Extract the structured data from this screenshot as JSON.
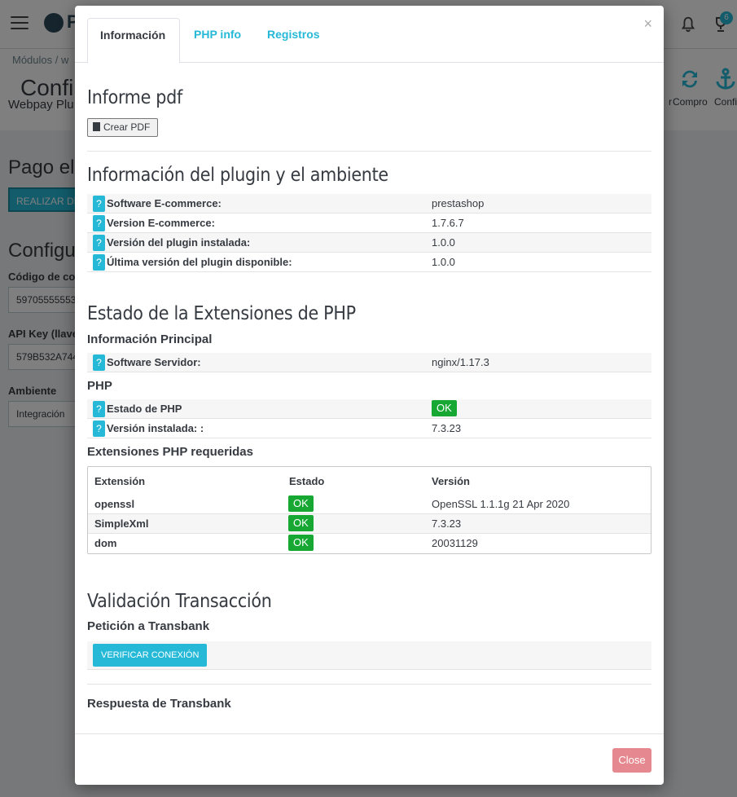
{
  "background": {
    "breadcrumb": "Módulos  /  w",
    "title": "Confi",
    "subtitle": "Webpay Plu",
    "toolbar": [
      {
        "label": "r",
        "icon": "sync-icon"
      },
      {
        "label": "Compro",
        "icon": "refresh-icon"
      },
      {
        "label": "Confi",
        "icon": "anchor-icon"
      }
    ],
    "notification_count": "6",
    "section1_title": "Pago elec",
    "action_button": "REALIZAR DIA",
    "section2_title": "Configura",
    "fields": [
      {
        "label": "Código de con",
        "value": "597055555532"
      },
      {
        "label": "API Key (llave",
        "value": "579B532A744"
      },
      {
        "label": "Ambiente",
        "value": "Integración"
      }
    ]
  },
  "modal": {
    "tabs": [
      "Información",
      "PHP info",
      "Registros"
    ],
    "close_symbol": "×",
    "pdf_section": {
      "title": "Informe pdf",
      "button": "Crear PDF"
    },
    "plugin_section": {
      "title": "Información del plugin y el ambiente",
      "rows": [
        {
          "key": "Software E-commerce:",
          "value": "prestashop"
        },
        {
          "key": "Version E-commerce:",
          "value": "1.7.6.7"
        },
        {
          "key": "Versión del plugin instalada:",
          "value": "1.0.0"
        },
        {
          "key": "Última versión del plugin disponible:",
          "value": "1.0.0"
        }
      ]
    },
    "php_section": {
      "title": "Estado de la Extensiones de PHP",
      "main_info_title": "Información Principal",
      "main_info_rows": [
        {
          "key": "Software Servidor:",
          "value": "nginx/1.17.3"
        }
      ],
      "php_title": "PHP",
      "php_rows": [
        {
          "key": "Estado de PHP",
          "value": "OK"
        },
        {
          "key": "Versión instalada: :",
          "value": "7.3.23"
        }
      ],
      "extensions_title": "Extensiones PHP requeridas",
      "extensions_headers": [
        "Extensión",
        "Estado",
        "Versión"
      ],
      "extensions": [
        {
          "name": "openssl",
          "status": "OK",
          "version": "OpenSSL 1.1.1g 21 Apr 2020"
        },
        {
          "name": "SimpleXml",
          "status": "OK",
          "version": "7.3.23"
        },
        {
          "name": "dom",
          "status": "OK",
          "version": "20031129"
        }
      ]
    },
    "validation_section": {
      "title": "Validación Transacción",
      "request_title": "Petición a Transbank",
      "verify_button": "VERIFICAR CONEXIÓN",
      "response_title": "Respuesta de Transbank"
    },
    "help_symbol": "?",
    "footer_close": "Close"
  },
  "colors": {
    "accent": "#25b9d7",
    "ok_green": "#17a833",
    "close_button": "#e6888f",
    "text": "#363a41"
  }
}
